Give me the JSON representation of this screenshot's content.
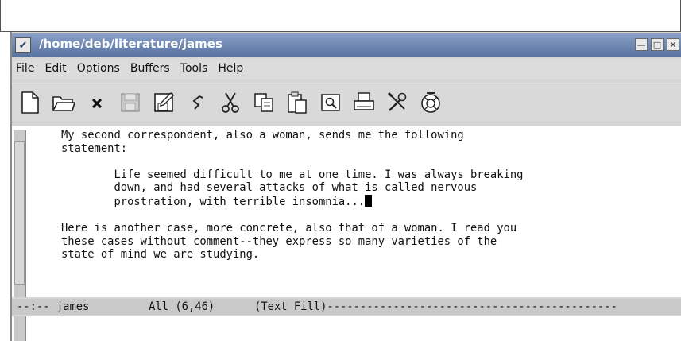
{
  "window": {
    "title": "/home/deb/literature/james"
  },
  "menubar": {
    "items": [
      "File",
      "Edit",
      "Options",
      "Buffers",
      "Tools",
      "Help"
    ]
  },
  "toolbar": {
    "icons": [
      "new-file",
      "open-folder",
      "close",
      "save",
      "save-as",
      "undo",
      "cut",
      "copy",
      "paste",
      "search",
      "print",
      "preferences",
      "help"
    ]
  },
  "buffer": {
    "lines": [
      "My second correspondent, also a woman, sends me the following",
      "statement:",
      "",
      "        Life seemed difficult to me at one time. I was always breaking",
      "        down, and had several attacks of what is called nervous",
      "        prostration, with terrible insomnia...",
      "",
      "Here is another case, more concrete, also that of a woman. I read you",
      "these cases without comment--they express so many varieties of the",
      "state of mind we are studying."
    ]
  },
  "modeline": {
    "text": "--:-- james         All (6,46)      (Text Fill)--------------------------------------------"
  }
}
